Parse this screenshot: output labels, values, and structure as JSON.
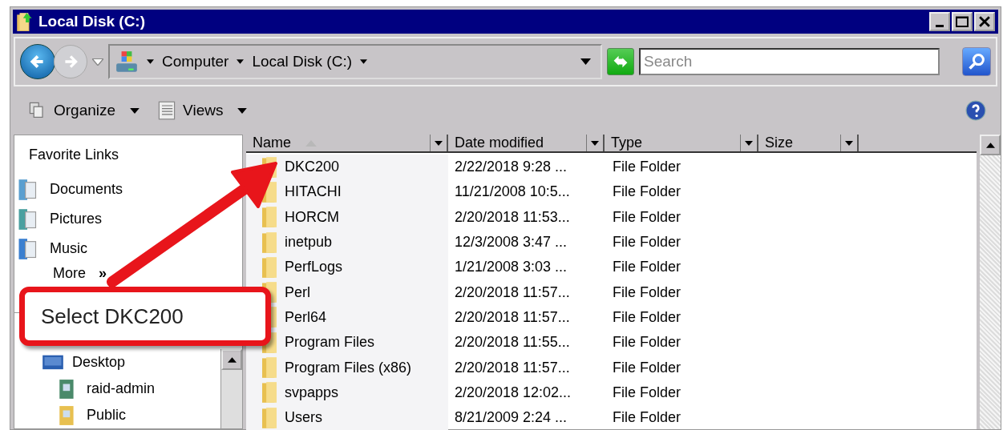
{
  "window": {
    "title": "Local Disk (C:)"
  },
  "address": {
    "crumbs": [
      "Computer",
      "Local Disk (C:)"
    ]
  },
  "search": {
    "placeholder": "Search"
  },
  "toolbar": [
    "Organize",
    "Views"
  ],
  "favorites": {
    "title": "Favorite Links",
    "items": [
      {
        "label": "Documents",
        "kind": "documents"
      },
      {
        "label": "Pictures",
        "kind": "pictures"
      },
      {
        "label": "Music",
        "kind": "music"
      }
    ],
    "more": "More",
    "more_glyph": "»"
  },
  "tree": [
    {
      "label": "Desktop",
      "kind": "desktop",
      "children": [
        {
          "label": "raid-admin",
          "kind": "user"
        },
        {
          "label": "Public",
          "kind": "folder"
        }
      ]
    }
  ],
  "columns": [
    {
      "label": "Name",
      "sorted": true
    },
    {
      "label": "Date modified",
      "sorted": false
    },
    {
      "label": "Type",
      "sorted": false
    },
    {
      "label": "Size",
      "sorted": false
    }
  ],
  "rows": [
    {
      "name": "DKC200",
      "date": "2/22/2018 9:28 ...",
      "type": "File Folder"
    },
    {
      "name": "HITACHI",
      "date": "11/21/2008 10:5...",
      "type": "File Folder"
    },
    {
      "name": "HORCM",
      "date": "2/20/2018 11:53...",
      "type": "File Folder"
    },
    {
      "name": "inetpub",
      "date": "12/3/2008 3:47 ...",
      "type": "File Folder"
    },
    {
      "name": "PerfLogs",
      "date": "1/21/2008 3:03 ...",
      "type": "File Folder"
    },
    {
      "name": "Perl",
      "date": "2/20/2018 11:57...",
      "type": "File Folder"
    },
    {
      "name": "Perl64",
      "date": "2/20/2018 11:57...",
      "type": "File Folder"
    },
    {
      "name": "Program Files",
      "date": "2/20/2018 11:55...",
      "type": "File Folder"
    },
    {
      "name": "Program Files (x86)",
      "date": "2/20/2018 11:57...",
      "type": "File Folder"
    },
    {
      "name": "svpapps",
      "date": "2/20/2018 12:02...",
      "type": "File Folder"
    },
    {
      "name": "Users",
      "date": "8/21/2009 2:24 ...",
      "type": "File Folder"
    }
  ],
  "callout": {
    "text": "Select DKC200"
  }
}
